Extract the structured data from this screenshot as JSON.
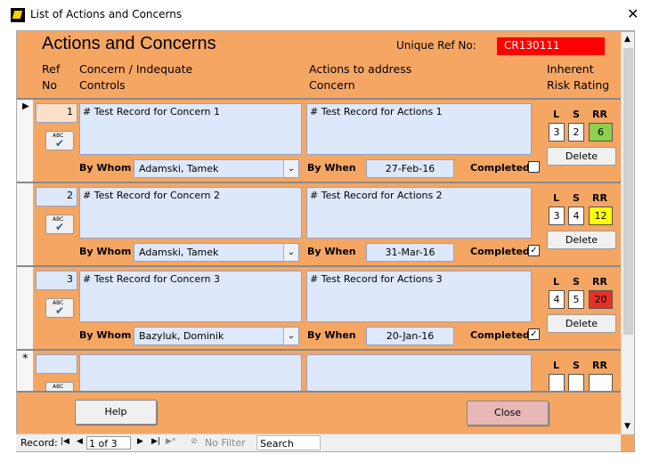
{
  "window": {
    "title": "List of Actions and Concerns",
    "close_glyph": "✕"
  },
  "form": {
    "heading": "Actions and Concerns",
    "unique_ref_label": "Unique Ref No:",
    "unique_ref_value": "CR130111",
    "col_ref_line1": "Ref",
    "col_ref_line2": "No",
    "col_concern_line1": "Concern / Indequate",
    "col_concern_line2": "Controls",
    "col_action_line1": "Actions to address",
    "col_action_line2": "Concern",
    "col_risk_line1": "Inherent",
    "col_risk_line2": "Risk Rating"
  },
  "labels": {
    "by_whom": "By Whom",
    "by_when": "By When",
    "completed": "Completed",
    "l": "L",
    "s": "S",
    "rr": "RR",
    "delete": "Delete",
    "abc": "ABC",
    "check": "✔"
  },
  "records": [
    {
      "ref": "1",
      "concern": "# Test Record for Concern 1",
      "action": "# Test Record for Actions 1",
      "by_whom": "Adamski, Tamek",
      "by_when": "27-Feb-16",
      "completed": "",
      "l": "3",
      "s": "2",
      "rr": "6",
      "rr_color": "#8fd14f"
    },
    {
      "ref": "2",
      "concern": "# Test Record for Concern 2",
      "action": "# Test Record for Actions 2",
      "by_whom": "Adamski, Tamek",
      "by_when": "31-Mar-16",
      "completed": "✓",
      "l": "3",
      "s": "4",
      "rr": "12",
      "rr_color": "#ffff00"
    },
    {
      "ref": "3",
      "concern": "# Test Record for Concern 3",
      "action": "# Test Record for Actions 3",
      "by_whom": "Bazyluk, Dominik",
      "by_when": "20-Jan-16",
      "completed": "✓",
      "l": "4",
      "s": "5",
      "rr": "20",
      "rr_color": "#e8302a"
    }
  ],
  "new_record_marker": "*",
  "current_record_marker": "▶",
  "footer": {
    "help": "Help",
    "close": "Close"
  },
  "navbar": {
    "record_label": "Record:",
    "position": "1 of 3",
    "filter": "No Filter",
    "search": "Search"
  }
}
